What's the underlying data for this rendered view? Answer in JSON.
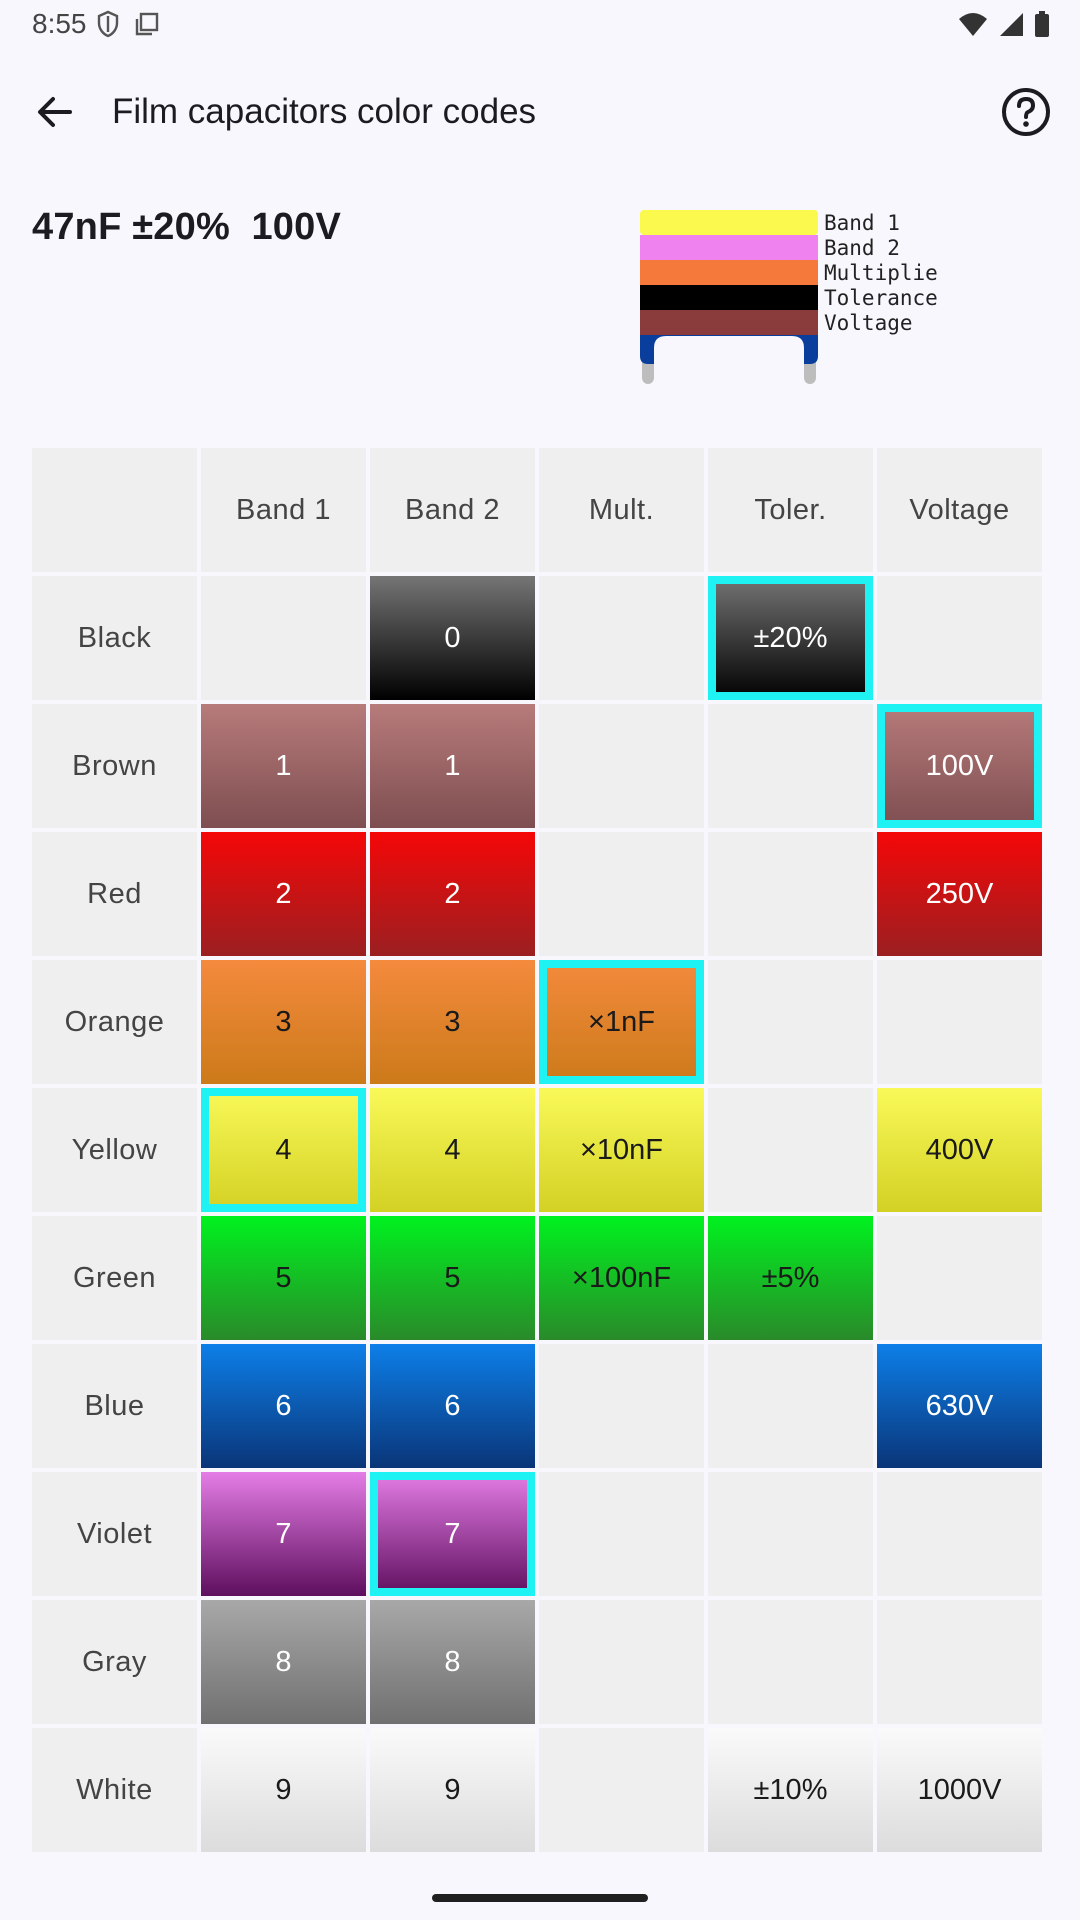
{
  "status_bar": {
    "time": "8:55"
  },
  "app_bar": {
    "title": "Film capacitors color codes"
  },
  "result": {
    "text": "47nF ±20%  100V"
  },
  "illustration": {
    "band_labels": [
      "Band 1",
      "Band 2",
      "Multiplie",
      "Tolerance",
      "Voltage"
    ],
    "band_colors": [
      "#fbf94e",
      "#ef82ef",
      "#f5793a",
      "#000000",
      "#8a3b3b"
    ]
  },
  "table": {
    "headers": [
      "",
      "Band 1",
      "Band 2",
      "Mult.",
      "Toler.",
      "Voltage"
    ],
    "rows": [
      {
        "label": "Black",
        "color": "black",
        "cells": [
          "",
          "0",
          "",
          "±20%",
          ""
        ]
      },
      {
        "label": "Brown",
        "color": "brown",
        "cells": [
          "1",
          "1",
          "",
          "",
          "100V"
        ]
      },
      {
        "label": "Red",
        "color": "red",
        "cells": [
          "2",
          "2",
          "",
          "",
          "250V"
        ]
      },
      {
        "label": "Orange",
        "color": "orange",
        "cells": [
          "3",
          "3",
          "×1nF",
          "",
          ""
        ]
      },
      {
        "label": "Yellow",
        "color": "yellow",
        "cells": [
          "4",
          "4",
          "×10nF",
          "",
          "400V"
        ]
      },
      {
        "label": "Green",
        "color": "green",
        "cells": [
          "5",
          "5",
          "×100nF",
          "±5%",
          ""
        ]
      },
      {
        "label": "Blue",
        "color": "blue",
        "cells": [
          "6",
          "6",
          "",
          "",
          "630V"
        ]
      },
      {
        "label": "Violet",
        "color": "violet",
        "cells": [
          "7",
          "7",
          "",
          "",
          ""
        ]
      },
      {
        "label": "Gray",
        "color": "gray",
        "cells": [
          "8",
          "8",
          "",
          "",
          ""
        ]
      },
      {
        "label": "White",
        "color": "white",
        "cells": [
          "9",
          "9",
          "",
          "±10%",
          "1000V"
        ]
      }
    ],
    "selected": {
      "band1": "Yellow",
      "band2": "Violet",
      "multiplier": "Orange",
      "tolerance": "Black",
      "voltage": "Brown"
    },
    "selection_color": "#1ef2f3"
  }
}
